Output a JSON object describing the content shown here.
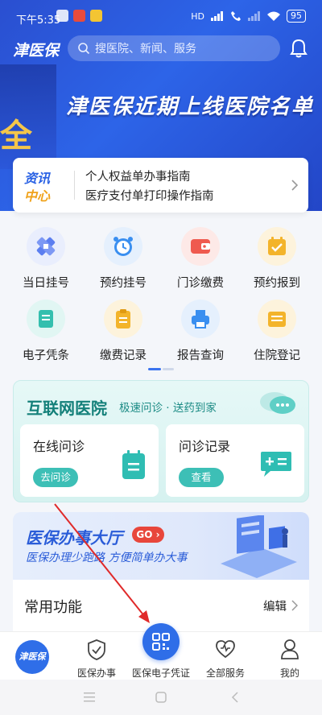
{
  "status_bar": {
    "time": "下午5:35",
    "battery": "95",
    "hd": "HD"
  },
  "header": {
    "logo": "津医保",
    "search_placeholder": "搜医院、新闻、服务"
  },
  "banner": {
    "headline": "津医保近期上线医院名单",
    "side_char": "全"
  },
  "news": {
    "badge_line1": "资讯",
    "badge_line2": "中心",
    "items": [
      "个人权益单办事指南",
      "医疗支付单打印操作指南"
    ]
  },
  "services": [
    {
      "label": "当日挂号",
      "icon": "hospital-cross-icon",
      "color": "#5b7ef0",
      "bg": "#e9eefd"
    },
    {
      "label": "预约挂号",
      "icon": "alarm-clock-icon",
      "color": "#3a8ff0",
      "bg": "#e5f0fd"
    },
    {
      "label": "门诊缴费",
      "icon": "wallet-icon",
      "color": "#ef5a4f",
      "bg": "#fde9e7"
    },
    {
      "label": "预约报到",
      "icon": "calendar-check-icon",
      "color": "#f3b42b",
      "bg": "#fdf3dc"
    },
    {
      "label": "电子凭条",
      "icon": "receipt-icon",
      "color": "#34bfae",
      "bg": "#e1f6f3"
    },
    {
      "label": "缴费记录",
      "icon": "clipboard-icon",
      "color": "#f3b42b",
      "bg": "#fdf3dc"
    },
    {
      "label": "报告查询",
      "icon": "printer-icon",
      "color": "#3a8ff0",
      "bg": "#e5f0fd"
    },
    {
      "label": "住院登记",
      "icon": "folder-icon",
      "color": "#f3b42b",
      "bg": "#fdf3dc"
    }
  ],
  "internet_hospital": {
    "title": "互联网医院",
    "subtitle": "极速问诊 · 送药到家",
    "online": {
      "title": "在线问诊",
      "button": "去问诊"
    },
    "records": {
      "title": "问诊记录",
      "button": "查看"
    }
  },
  "hall": {
    "title": "医保办事大厅",
    "go": "GO",
    "subtitle": "医保办理少跑路 方便简单办大事"
  },
  "common": {
    "title": "常用功能",
    "edit": "编辑"
  },
  "bottom_nav": {
    "logo": "津医保",
    "items": [
      "医保办事",
      "医保电子凭证",
      "全部服务",
      "我的"
    ]
  },
  "colors": {
    "primary": "#2f6ee8",
    "teal": "#14807a"
  }
}
